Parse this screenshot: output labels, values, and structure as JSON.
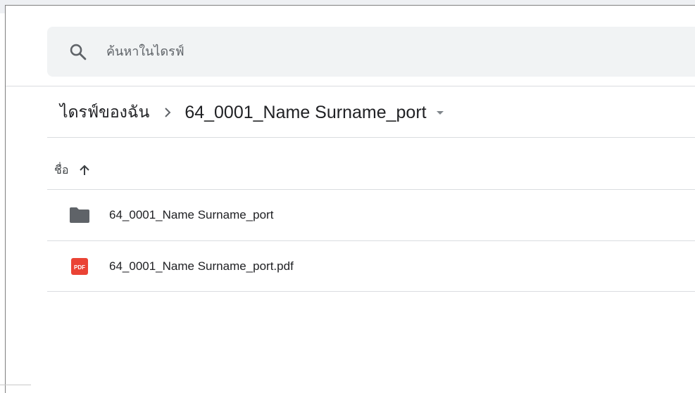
{
  "search": {
    "placeholder": "ค้นหาในไดรฟ์",
    "icon": "search-icon"
  },
  "breadcrumb": {
    "root_label": "ไดรฟ์ของฉัน",
    "separator_icon": "chevron-right-icon",
    "current_label": "64_0001_Name Surname_port",
    "dropdown_icon": "caret-down-icon"
  },
  "list_header": {
    "name_label": "ชื่อ",
    "sort_icon": "arrow-up-icon",
    "sort_direction": "ascending"
  },
  "files": [
    {
      "name": "64_0001_Name Surname_port",
      "type": "folder",
      "icon": "folder-icon",
      "icon_color": "#5f6368"
    },
    {
      "name": "64_0001_Name Surname_port.pdf",
      "type": "pdf",
      "icon": "pdf-icon",
      "icon_color": "#ea4335",
      "icon_text": "PDF"
    }
  ],
  "colors": {
    "search_background": "#f1f3f4",
    "divider": "#dadce0",
    "text_primary": "#202124",
    "text_secondary": "#5f6368"
  }
}
